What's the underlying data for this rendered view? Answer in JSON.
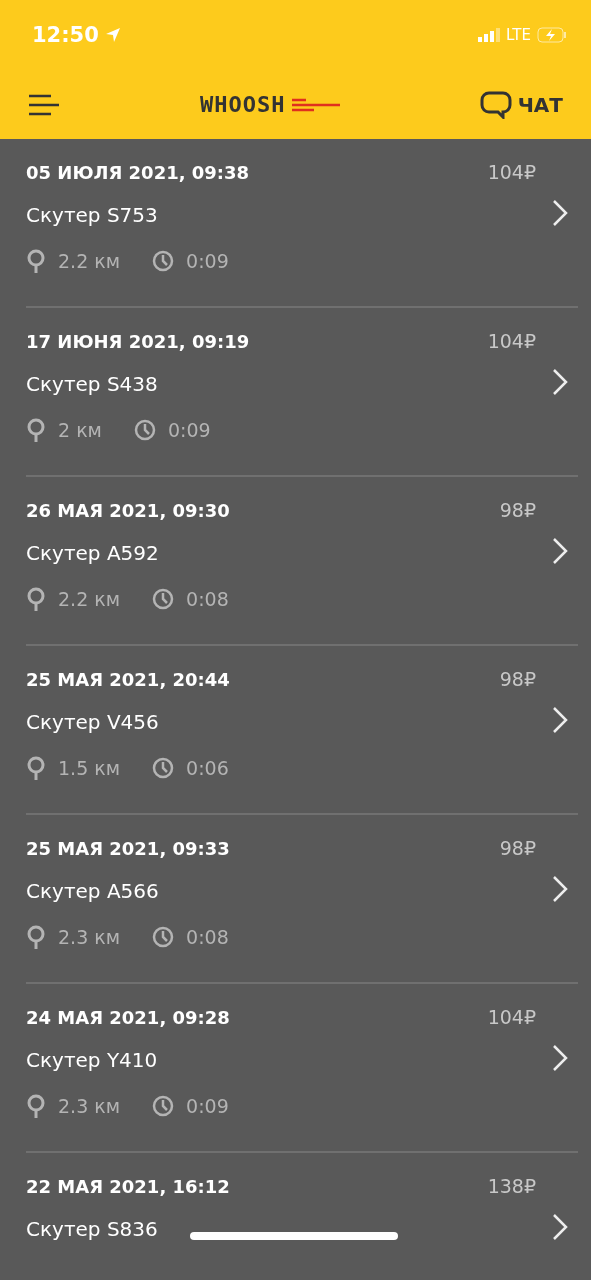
{
  "status_bar": {
    "time": "12:50",
    "network": "LTE"
  },
  "header": {
    "logo": "WHOOSH",
    "chat": "ЧАТ"
  },
  "rides": [
    {
      "date": "05 ИЮЛЯ 2021, 09:38",
      "price": "104₽",
      "scooter": "Скутер S753",
      "distance": "2.2 км",
      "duration": "0:09"
    },
    {
      "date": "17 ИЮНЯ 2021, 09:19",
      "price": "104₽",
      "scooter": "Скутер S438",
      "distance": "2 км",
      "duration": "0:09"
    },
    {
      "date": "26 МАЯ 2021, 09:30",
      "price": "98₽",
      "scooter": "Скутер A592",
      "distance": "2.2 км",
      "duration": "0:08"
    },
    {
      "date": "25 МАЯ 2021, 20:44",
      "price": "98₽",
      "scooter": "Скутер V456",
      "distance": "1.5 км",
      "duration": "0:06"
    },
    {
      "date": "25 МАЯ 2021, 09:33",
      "price": "98₽",
      "scooter": "Скутер A566",
      "distance": "2.3 км",
      "duration": "0:08"
    },
    {
      "date": "24 МАЯ 2021, 09:28",
      "price": "104₽",
      "scooter": "Скутер Y410",
      "distance": "2.3 км",
      "duration": "0:09"
    },
    {
      "date": "22 МАЯ 2021, 16:12",
      "price": "138₽",
      "scooter": "Скутер S836"
    }
  ]
}
